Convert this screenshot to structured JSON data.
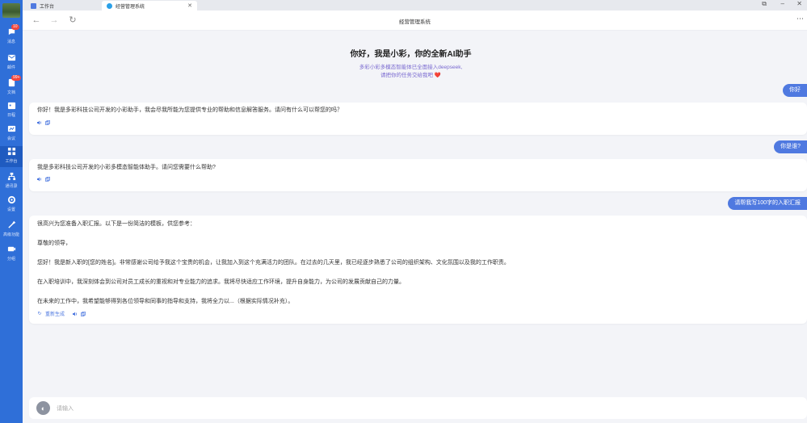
{
  "tabs": [
    {
      "label": "工作台"
    },
    {
      "label": "经营管理系统"
    }
  ],
  "toolbar": {
    "title": "经营管理系统"
  },
  "sidebar": {
    "items": [
      {
        "label": "消息",
        "badge": "10",
        "icon": "message-icon"
      },
      {
        "label": "邮件",
        "badge": "",
        "icon": "mail-icon"
      },
      {
        "label": "文档",
        "badge": "99+",
        "icon": "document-icon"
      },
      {
        "label": "日程",
        "badge": "",
        "icon": "calendar-icon"
      },
      {
        "label": "会议",
        "badge": "",
        "icon": "meeting-icon"
      },
      {
        "label": "工作台",
        "badge": "",
        "icon": "workbench-icon"
      },
      {
        "label": "通讯录",
        "badge": "",
        "icon": "contacts-icon"
      },
      {
        "label": "设置",
        "badge": "",
        "icon": "settings-icon"
      },
      {
        "label": "高级功能",
        "badge": "",
        "icon": "advanced-icon"
      },
      {
        "label": "分组",
        "badge": "",
        "icon": "group-icon"
      }
    ]
  },
  "welcome": {
    "title": "你好，我是小彩，你的全新AI助手",
    "line1": "多彩小彩多模态智能体已全面接入deepseek,",
    "line2": "请把你的任务交给我吧",
    "heart": "❤️"
  },
  "messages": [
    {
      "role": "user",
      "text": "你好"
    },
    {
      "role": "assistant",
      "lines": [
        "你好！我是多彩科技公司开发的小彩助手，我会尽我所能为您提供专业的帮助和信息解答服务。请问有什么可以帮您的吗？"
      ]
    },
    {
      "role": "user",
      "text": "你是谁?"
    },
    {
      "role": "assistant",
      "lines": [
        "我是多彩科技公司开发的小彩多模态智能体助手。请问您需要什么帮助?"
      ]
    },
    {
      "role": "user",
      "text": "请帮我写100字的入职汇报"
    },
    {
      "role": "assistant",
      "lines": [
        "很高兴为您准备入职汇报。以下是一份简洁的模板，供您参考：",
        "尊敬的领导，",
        "您好！我是新入职的[您的姓名]。非常感谢公司给予我这个宝贵的机会，让我加入到这个充满活力的团队。在过去的几天里，我已经逐步熟悉了公司的组织架构、文化氛围以及我的工作职责。",
        "在入职培训中，我深刻体会到公司对员工成长的重视和对专业能力的追求。我将尽快适应工作环境，提升自身能力，为公司的发展贡献自己的力量。",
        "在未来的工作中，我希望能够得到各位领导和同事的指导和支持，我将全力以...（根据实际情况补充）。"
      ],
      "regenerate": "重新生成"
    }
  ],
  "input": {
    "placeholder": "请输入"
  },
  "colors": {
    "sidebar": "#2f6fd8",
    "accent": "#4f79e0",
    "badge": "#f2463d"
  }
}
